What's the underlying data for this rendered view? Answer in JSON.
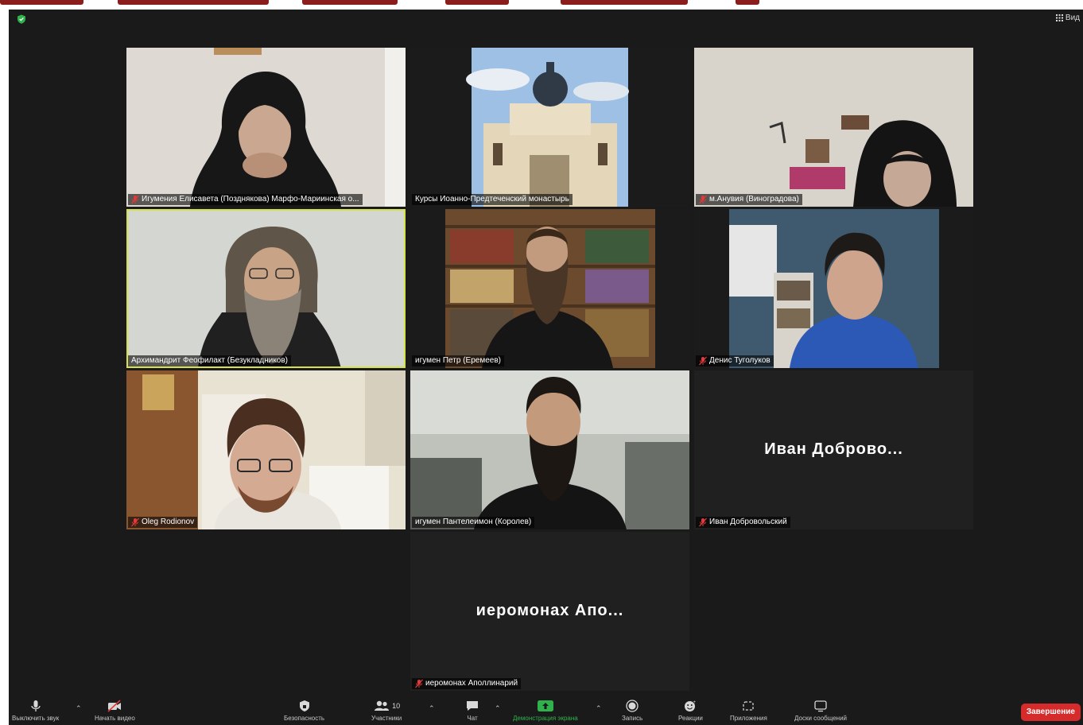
{
  "colors": {
    "accent_speaker": "#d6e24b",
    "end_button": "#d62b2b",
    "share_green": "#2fb24c",
    "banner": "#8c1d1d"
  },
  "top_bar": {
    "view_label": "Вид"
  },
  "participants": [
    {
      "name": "Игумения Елисавета (Позднякова) Марфо-Мариинская о...",
      "muted": true,
      "video": true,
      "speaking": false
    },
    {
      "name": "Курсы Иоанно-Предтеченский монастырь",
      "muted": false,
      "video": true,
      "speaking": false
    },
    {
      "name": "м.Анувия (Виноградова)",
      "muted": true,
      "video": true,
      "speaking": false
    },
    {
      "name": "Архимандрит Феофилакт (Безукладников)",
      "muted": false,
      "video": true,
      "speaking": true
    },
    {
      "name": "игумен Петр (Еремеев)",
      "muted": false,
      "video": true,
      "speaking": false
    },
    {
      "name": "Денис Туголуков",
      "muted": true,
      "video": true,
      "speaking": false
    },
    {
      "name": "Oleg Rodionov",
      "muted": true,
      "video": true,
      "speaking": false
    },
    {
      "name": "игумен Пантелеимон (Королев)",
      "muted": false,
      "video": true,
      "speaking": false
    },
    {
      "name": "Иван Добровольский",
      "muted": true,
      "video": false,
      "speaking": false,
      "display_name": "Иван  Доброво..."
    },
    {
      "name": "иеромонах Аполлинарий",
      "muted": true,
      "video": false,
      "speaking": false,
      "display_name": "иеромонах  Апо..."
    }
  ],
  "toolbar": {
    "mute_label": "Выключить звук",
    "video_label": "Начать видео",
    "security_label": "Безопасность",
    "participants_label": "Участники",
    "participants_count": "10",
    "chat_label": "Чат",
    "share_label": "Демонстрация экрана",
    "record_label": "Запись",
    "reactions_label": "Реакции",
    "apps_label": "Приложения",
    "whiteboard_label": "Доски сообщений",
    "end_label": "Завершение"
  }
}
